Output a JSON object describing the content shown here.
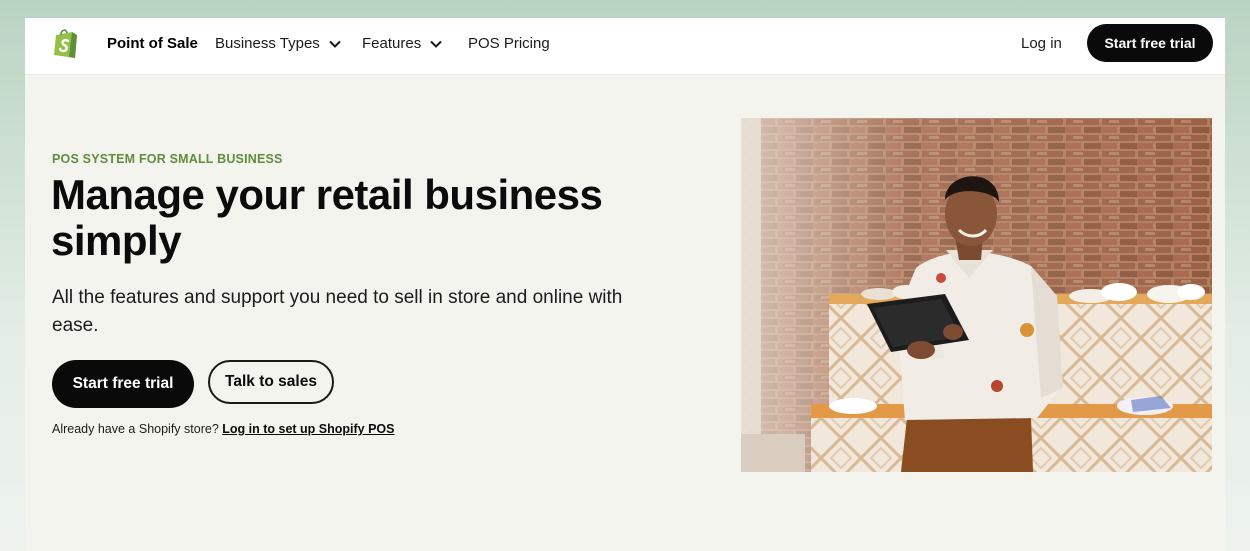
{
  "nav": {
    "logo_icon": "shopify-bag-icon",
    "brand_label": "Point of Sale",
    "items": [
      {
        "label": "Business Types",
        "icon": "chevron-down-icon"
      },
      {
        "label": "Features",
        "icon": "chevron-down-icon"
      },
      {
        "label": "POS Pricing"
      }
    ],
    "login_label": "Log in",
    "cta_label": "Start free trial"
  },
  "hero": {
    "eyebrow": "POS SYSTEM FOR SMALL BUSINESS",
    "headline": "Manage your retail business simply",
    "subhead": "All the features and support you need to sell in store and online with ease.",
    "primary_button": "Start free trial",
    "secondary_button": "Talk to sales",
    "already_text": "Already have a Shopify store?",
    "already_link": "Log in to set up Shopify POS",
    "image": "photo of smiling woman holding a tablet in a shoe store with brick wall"
  },
  "colors": {
    "accent_green": "#5e8e3e",
    "button_dark": "#0a0a0a",
    "hero_bg": "#f4f4ee"
  }
}
